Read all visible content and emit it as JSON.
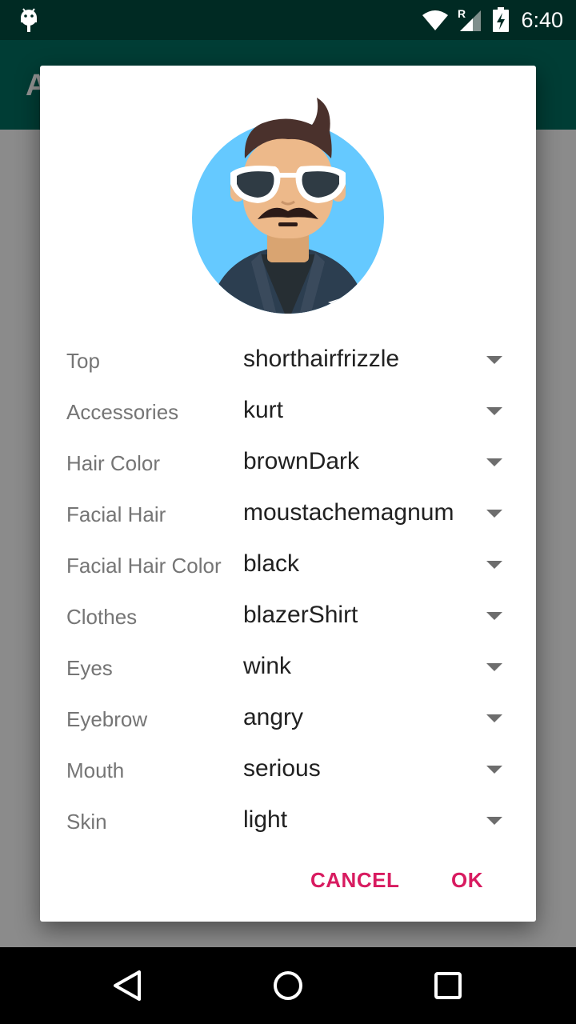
{
  "status_bar": {
    "time": "6:40",
    "roaming": "R"
  },
  "app_bar": {
    "title": "A"
  },
  "dialog": {
    "rows": [
      {
        "label": "Top",
        "value": "shorthairfrizzle"
      },
      {
        "label": "Accessories",
        "value": "kurt"
      },
      {
        "label": "Hair Color",
        "value": "brownDark"
      },
      {
        "label": "Facial Hair",
        "value": "moustachemagnum"
      },
      {
        "label": "Facial Hair Color",
        "value": "black"
      },
      {
        "label": "Clothes",
        "value": "blazerShirt"
      },
      {
        "label": "Eyes",
        "value": "wink"
      },
      {
        "label": "Eyebrow",
        "value": "angry"
      },
      {
        "label": "Mouth",
        "value": "serious"
      },
      {
        "label": "Skin",
        "value": "light"
      }
    ],
    "cancel_label": "CANCEL",
    "ok_label": "OK"
  },
  "colors": {
    "accent": "#d81b60",
    "primary": "#00695c",
    "avatar_bg": "#65c9ff"
  }
}
